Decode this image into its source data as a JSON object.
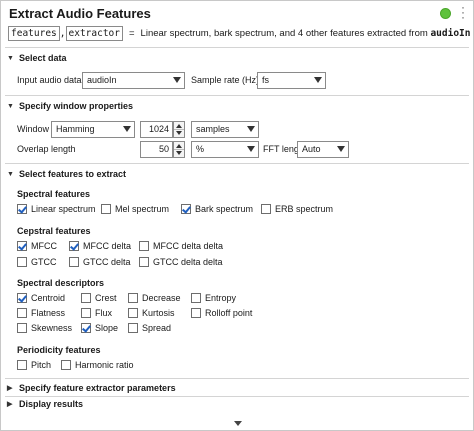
{
  "header": {
    "title": "Extract Audio Features",
    "status_color": "#5fc23d",
    "code": {
      "var1": "features",
      "sep": ",",
      "var2": "extractor",
      "equals": "=",
      "description": "Linear spectrum, bark spectrum, and 4 other features extracted from",
      "input_name": "audioIn"
    }
  },
  "select_data": {
    "title": "Select data",
    "input_label": "Input audio data",
    "input_value": "audioIn",
    "rate_label": "Sample rate (Hz)",
    "rate_value": "fs"
  },
  "window": {
    "title": "Specify window properties",
    "window_label": "Window",
    "window_value": "Hamming",
    "length_value": "1024",
    "length_unit": "samples",
    "overlap_label": "Overlap length",
    "overlap_value": "50",
    "overlap_unit": "%",
    "fft_label": "FFT length",
    "fft_value": "Auto"
  },
  "features": {
    "title": "Select features to extract",
    "spectral": {
      "title": "Spectral features",
      "items": [
        {
          "label": "Linear spectrum",
          "checked": true
        },
        {
          "label": "Mel spectrum",
          "checked": false
        },
        {
          "label": "Bark spectrum",
          "checked": true
        },
        {
          "label": "ERB spectrum",
          "checked": false
        }
      ]
    },
    "cepstral": {
      "title": "Cepstral features",
      "items": [
        {
          "label": "MFCC",
          "checked": true
        },
        {
          "label": "MFCC delta",
          "checked": true
        },
        {
          "label": "MFCC delta delta",
          "checked": false
        },
        {
          "label": "GTCC",
          "checked": false
        },
        {
          "label": "GTCC delta",
          "checked": false
        },
        {
          "label": "GTCC delta delta",
          "checked": false
        }
      ]
    },
    "descriptors": {
      "title": "Spectral descriptors",
      "items": [
        {
          "label": "Centroid",
          "checked": true
        },
        {
          "label": "Crest",
          "checked": false
        },
        {
          "label": "Decrease",
          "checked": false
        },
        {
          "label": "Entropy",
          "checked": false
        },
        {
          "label": "Flatness",
          "checked": false
        },
        {
          "label": "Flux",
          "checked": false
        },
        {
          "label": "Kurtosis",
          "checked": false
        },
        {
          "label": "Rolloff point",
          "checked": false
        },
        {
          "label": "Skewness",
          "checked": false
        },
        {
          "label": "Slope",
          "checked": true
        },
        {
          "label": "Spread",
          "checked": false
        }
      ]
    },
    "periodicity": {
      "title": "Periodicity features",
      "items": [
        {
          "label": "Pitch",
          "checked": false
        },
        {
          "label": "Harmonic ratio",
          "checked": false
        }
      ]
    }
  },
  "collapsed": {
    "params": "Specify feature extractor parameters",
    "display": "Display results"
  },
  "glyphs": {
    "expanded": "▼",
    "collapsed": "▶"
  }
}
